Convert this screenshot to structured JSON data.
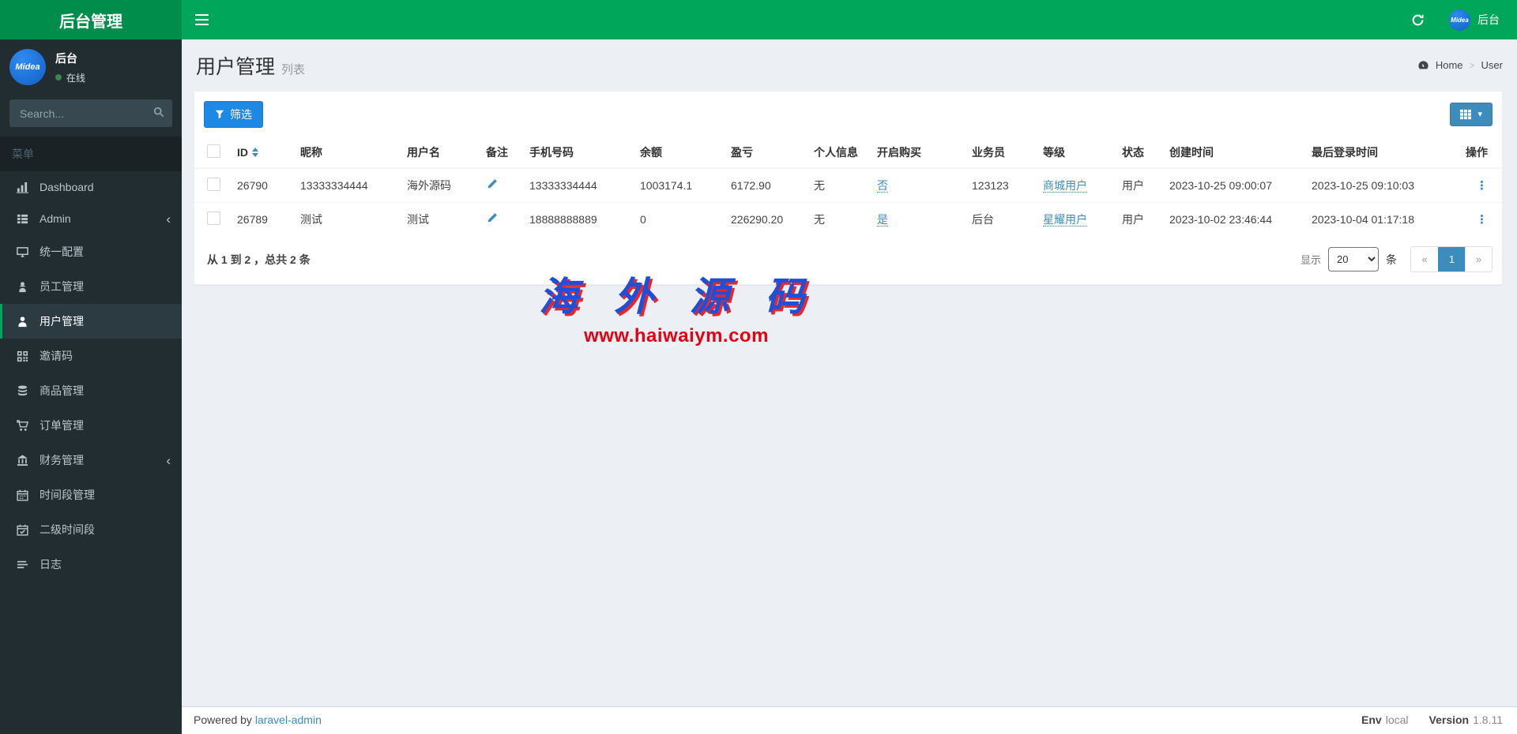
{
  "app": {
    "brand": "后台管理",
    "topbar_user": "后台",
    "avatar_text": "Midea"
  },
  "colors": {
    "navbar_green": "#00a65a",
    "brand_green": "#008d4c",
    "sidebar_dark": "#222d32",
    "primary_blue": "#3c8dbc",
    "filter_blue": "#1e88e5",
    "link_blue": "#3c8dbc",
    "watermark_blue": "#1d4fd8",
    "watermark_red": "#e60012"
  },
  "icons": {
    "ellipsis_v": "⋮",
    "chevron_left": "‹",
    "caret_down": "▾",
    "prev": "«",
    "next": "»"
  },
  "sidebar": {
    "user": {
      "name": "后台",
      "status": "在线"
    },
    "search_placeholder": "Search...",
    "section_label": "菜单",
    "items": [
      {
        "label": "Dashboard"
      },
      {
        "label": "Admin"
      },
      {
        "label": "统一配置"
      },
      {
        "label": "员工管理"
      },
      {
        "label": "用户管理"
      },
      {
        "label": "邀请码"
      },
      {
        "label": "商品管理"
      },
      {
        "label": "订单管理"
      },
      {
        "label": "财务管理"
      },
      {
        "label": "时间段管理"
      },
      {
        "label": "二级时间段"
      },
      {
        "label": "日志"
      }
    ]
  },
  "header": {
    "title": "用户管理",
    "subtitle": "列表",
    "breadcrumb_home": "Home",
    "breadcrumb_current": "User"
  },
  "toolbar": {
    "filter_label": "筛选"
  },
  "table": {
    "columns": {
      "id": "ID",
      "nickname": "昵称",
      "username": "用户名",
      "remark": "备注",
      "phone": "手机号码",
      "balance": "余额",
      "profit": "盈亏",
      "personal_info": "个人信息",
      "buy_enabled": "开启购买",
      "salesman": "业务员",
      "level": "等级",
      "status": "状态",
      "created_at": "创建时间",
      "last_login": "最后登录时间",
      "operation": "操作"
    },
    "rows": [
      {
        "id": "26790",
        "nickname": "13333334444",
        "username": "海外源码",
        "phone": "13333334444",
        "balance": "1003174.1",
        "profit": "6172.90",
        "personal_info": "无",
        "buy_enabled": "否",
        "salesman": "123123",
        "level": "商城用户",
        "status": "用户",
        "created_at": "2023-10-25 09:00:07",
        "last_login": "2023-10-25 09:10:03"
      },
      {
        "id": "26789",
        "nickname": "测试",
        "username": "测试",
        "phone": "18888888889",
        "balance": "0",
        "profit": "226290.20",
        "personal_info": "无",
        "buy_enabled": "是",
        "salesman": "后台",
        "level": "星耀用户",
        "status": "用户",
        "created_at": "2023-10-02 23:46:44",
        "last_login": "2023-10-04 01:17:18"
      }
    ]
  },
  "pagination": {
    "summary": "从 1 到 2 ，总共 2 条",
    "show_label": "显示",
    "per_page": "20",
    "unit_label": "条",
    "active_page": "1"
  },
  "watermark": {
    "line1": "海 外 源 码",
    "line2": "www.haiwaiym.com"
  },
  "footer": {
    "powered_by": "Powered by",
    "link": "laravel-admin",
    "env_label": "Env",
    "env_value": "local",
    "version_label": "Version",
    "version_value": "1.8.11"
  }
}
